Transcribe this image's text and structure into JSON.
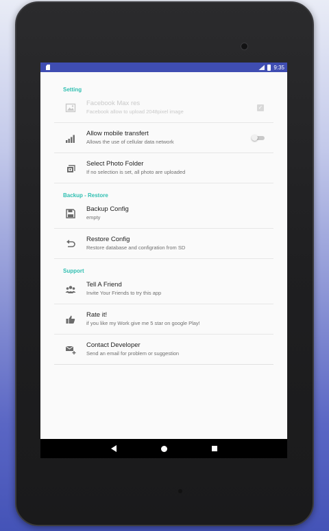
{
  "status_bar": {
    "time": "9:35"
  },
  "sections": [
    {
      "header": "Setting",
      "items": [
        {
          "title": "Facebook Max res",
          "subtitle": "Facebook allow to upload 2048pixel image",
          "icon": "image-icon",
          "control": "checkbox",
          "checked": true,
          "enabled": false
        },
        {
          "title": "Allow mobile transfert",
          "subtitle": "Allows the use of cellular data network",
          "icon": "signal-bars-icon",
          "control": "switch",
          "checked": false,
          "enabled": true
        },
        {
          "title": "Select Photo Folder",
          "subtitle": "If no selection is set, all photo are uploaded",
          "icon": "photo-folder-icon",
          "control": "none",
          "enabled": true
        }
      ]
    },
    {
      "header": "Backup - Restore",
      "items": [
        {
          "title": "Backup Config",
          "subtitle": "empty",
          "icon": "save-icon"
        },
        {
          "title": "Restore Config",
          "subtitle": "Restore database and configration from SD",
          "icon": "undo-icon"
        }
      ]
    },
    {
      "header": "Support",
      "items": [
        {
          "title": "Tell A Friend",
          "subtitle": "Invite Your Friends to try this app",
          "icon": "group-icon"
        },
        {
          "title": "Rate it!",
          "subtitle": "if you like my Work give me 5 star on google Play!",
          "icon": "thumbs-up-icon"
        },
        {
          "title": "Contact Developer",
          "subtitle": "Send an email for problem or suggestion",
          "icon": "mail-add-icon"
        }
      ]
    }
  ],
  "checkbox_glyph": "✓",
  "colors": {
    "status_bar": "#3f4db2",
    "section_header": "#2fbfb1"
  }
}
